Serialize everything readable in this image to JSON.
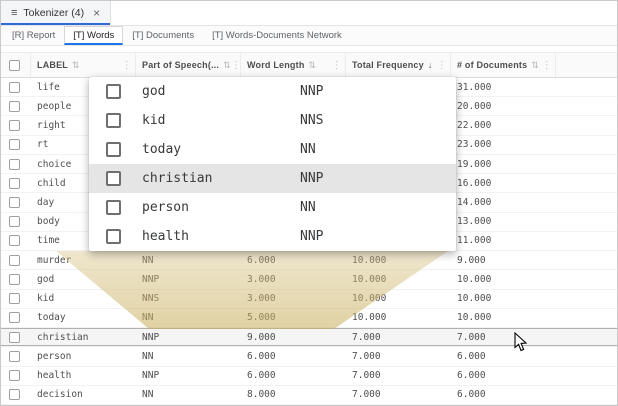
{
  "colors": {
    "accent_blue": "#1a73e8",
    "tab_underline_blue": "#2f6bd8",
    "drag_tint": "#d7c280",
    "overlay_highlight": "#e5e5e5"
  },
  "document_tab": {
    "menu_icon": "≡",
    "title": "Tokenizer (4)",
    "close_icon": "×"
  },
  "nav_tabs": [
    {
      "label": "[R] Report",
      "active": false
    },
    {
      "label": "[T] Words",
      "active": true
    },
    {
      "label": "[T] Documents",
      "active": false
    },
    {
      "label": "[T] Words-Documents Network",
      "active": false
    }
  ],
  "table": {
    "columns": [
      {
        "label": "LABEL",
        "sort_icon": "⇅",
        "menu_icon": "⋮",
        "sorted": false
      },
      {
        "label": "Part of Speech(...",
        "sort_icon": "⇅",
        "menu_icon": "⋮",
        "sorted": false
      },
      {
        "label": "Word Length",
        "sort_icon": "⇅",
        "menu_icon": "⋮",
        "sorted": false
      },
      {
        "label": "Total Frequency",
        "sort_icon": "↓",
        "menu_icon": "⋮",
        "sorted": true
      },
      {
        "label": "# of Documents",
        "sort_icon": "⇅",
        "menu_icon": "⋮",
        "sorted": false
      }
    ],
    "rows": [
      {
        "label": "life",
        "pos": "",
        "word_length": "",
        "total_frequency": "",
        "documents": "31.000",
        "state": "covered"
      },
      {
        "label": "people",
        "pos": "",
        "word_length": "",
        "total_frequency": "",
        "documents": "20.000",
        "state": "covered"
      },
      {
        "label": "right",
        "pos": "",
        "word_length": "",
        "total_frequency": "",
        "documents": "22.000",
        "state": "covered"
      },
      {
        "label": "rt",
        "pos": "",
        "word_length": "",
        "total_frequency": "",
        "documents": "23.000",
        "state": "covered"
      },
      {
        "label": "choice",
        "pos": "",
        "word_length": "",
        "total_frequency": "",
        "documents": "19.000",
        "state": "covered"
      },
      {
        "label": "child",
        "pos": "",
        "word_length": "",
        "total_frequency": "",
        "documents": "16.000",
        "state": "covered"
      },
      {
        "label": "day",
        "pos": "",
        "word_length": "",
        "total_frequency": "",
        "documents": "14.000",
        "state": "covered"
      },
      {
        "label": "body",
        "pos": "",
        "word_length": "",
        "total_frequency": "",
        "documents": "13.000",
        "state": "covered"
      },
      {
        "label": "time",
        "pos": "",
        "word_length": "",
        "total_frequency": "",
        "documents": "11.000",
        "state": "covered"
      },
      {
        "label": "murder",
        "pos": "NN",
        "word_length": "6.000",
        "total_frequency": "10.000",
        "documents": "9.000",
        "state": "drag-source"
      },
      {
        "label": "god",
        "pos": "NNP",
        "word_length": "3.000",
        "total_frequency": "10.000",
        "documents": "10.000",
        "state": "drag-source"
      },
      {
        "label": "kid",
        "pos": "NNS",
        "word_length": "3.000",
        "total_frequency": "10.000",
        "documents": "10.000",
        "state": "drag-source"
      },
      {
        "label": "today",
        "pos": "NN",
        "word_length": "5.000",
        "total_frequency": "10.000",
        "documents": "10.000",
        "state": "drag-source"
      },
      {
        "label": "christian",
        "pos": "NNP",
        "word_length": "9.000",
        "total_frequency": "7.000",
        "documents": "7.000",
        "state": "drop-target"
      },
      {
        "label": "person",
        "pos": "NN",
        "word_length": "6.000",
        "total_frequency": "7.000",
        "documents": "6.000",
        "state": "normal"
      },
      {
        "label": "health",
        "pos": "NNP",
        "word_length": "6.000",
        "total_frequency": "7.000",
        "documents": "6.000",
        "state": "normal"
      },
      {
        "label": "decision",
        "pos": "NN",
        "word_length": "8.000",
        "total_frequency": "7.000",
        "documents": "6.000",
        "state": "normal"
      }
    ]
  },
  "drag_overlay": {
    "rows": [
      {
        "label": "god",
        "pos": "NNP",
        "highlighted": false
      },
      {
        "label": "kid",
        "pos": "NNS",
        "highlighted": false
      },
      {
        "label": "today",
        "pos": "NN",
        "highlighted": false
      },
      {
        "label": "christian",
        "pos": "NNP",
        "highlighted": true
      },
      {
        "label": "person",
        "pos": "NN",
        "highlighted": false
      },
      {
        "label": "health",
        "pos": "NNP",
        "highlighted": false
      }
    ]
  }
}
